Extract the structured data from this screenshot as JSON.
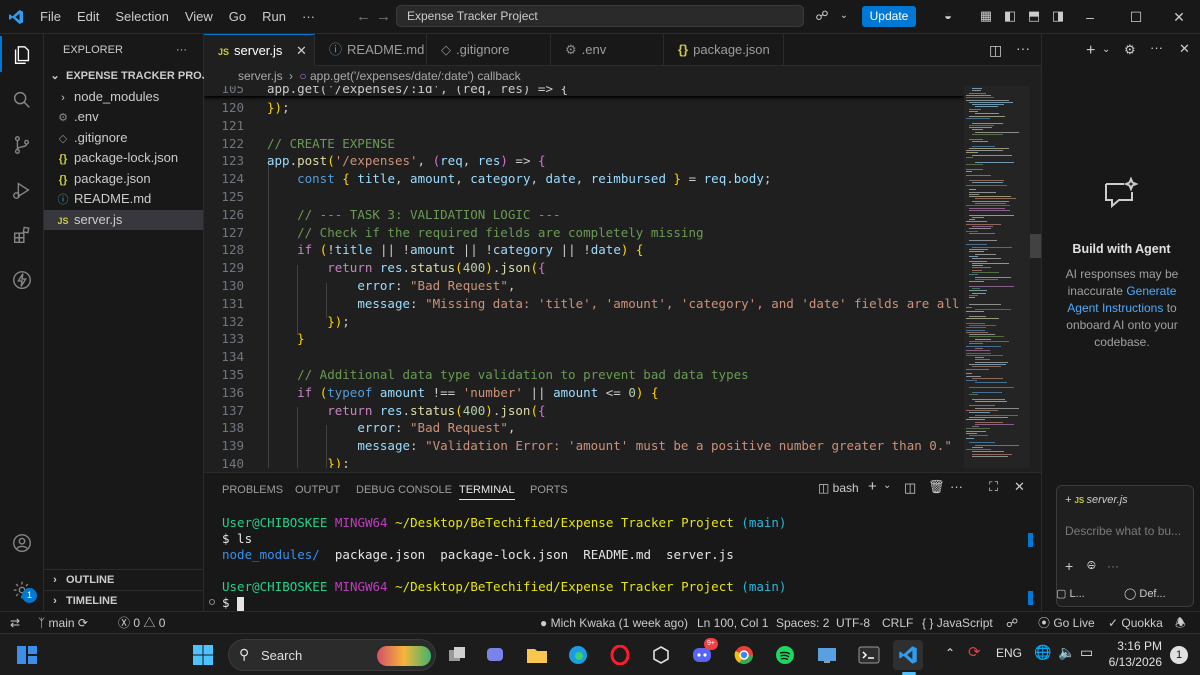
{
  "titlebar": {
    "menu": [
      "File",
      "Edit",
      "Selection",
      "View",
      "Go",
      "Run",
      "···"
    ],
    "command_center": "Expense Tracker Project",
    "update_label": "Update"
  },
  "explorer": {
    "title": "EXPLORER",
    "project": "EXPENSE TRACKER PROJECT",
    "items": [
      {
        "icon": "›",
        "label": "node_modules"
      },
      {
        "icon": "⚙",
        "label": ".env"
      },
      {
        "icon": "◇",
        "label": ".gitignore"
      },
      {
        "icon": "{}",
        "label": "package-lock.json"
      },
      {
        "icon": "{}",
        "label": "package.json"
      },
      {
        "icon": "ⓘ",
        "label": "README.md"
      },
      {
        "icon": "JS",
        "label": "server.js"
      }
    ],
    "outline": "OUTLINE",
    "timeline": "TIMELINE",
    "accounts_badge": "1"
  },
  "tabs": [
    {
      "icon": "JS",
      "label": "server.js"
    },
    {
      "icon": "ⓘ",
      "label": "README.md"
    },
    {
      "icon": "◇",
      "label": ".gitignore"
    },
    {
      "icon": "⚙",
      "label": ".env"
    },
    {
      "icon": "{}",
      "label": "package.json"
    }
  ],
  "breadcrumbs": {
    "file": "server.js",
    "separator": "›",
    "symbol": "app.get('/expenses/date/:date') callback"
  },
  "code": {
    "sticky_line_number": "105",
    "sticky_text": "app.get('/expenses/:id', (req, res) => {",
    "line_numbers": [
      "120",
      "121",
      "122",
      "123",
      "124",
      "125",
      "126",
      "127",
      "128",
      "129",
      "130",
      "131",
      "132",
      "133",
      "134",
      "135",
      "136",
      "137",
      "138",
      "139",
      "140"
    ],
    "lines": [
      "});",
      "",
      "// CREATE EXPENSE",
      "app.post('/expenses', (req, res) => {",
      "    const { title, amount, category, date, reimbursed } = req.body;",
      "",
      "    // --- TASK 3: VALIDATION LOGIC ---",
      "    // Check if the required fields are completely missing",
      "    if (!title || !amount || !category || !date) {",
      "        return res.status(400).json({",
      "            error: \"Bad Request\",",
      "            message: \"Missing data: 'title', 'amount', 'category', and 'date' fields are all req",
      "        });",
      "    }",
      "",
      "    // Additional data type validation to prevent bad data types",
      "    if (typeof amount !== 'number' || amount <= 0) {",
      "        return res.status(400).json({",
      "            error: \"Bad Request\",",
      "            message: \"Validation Error: 'amount' must be a positive number greater than 0.\"",
      "        });"
    ]
  },
  "panel": {
    "tabs": [
      "PROBLEMS",
      "OUTPUT",
      "DEBUG CONSOLE",
      "TERMINAL",
      "PORTS"
    ],
    "shell": "bash",
    "terminal": {
      "prompt_user": "User@CHIBOSKEE",
      "prompt_env": "MINGW64",
      "prompt_path": "~/Desktop/BeTechified/Expense Tracker Project",
      "prompt_branch": "(main)",
      "command": "$ ls",
      "ls_dir": "node_modules/",
      "ls_files": "  package.json  package-lock.json  README.md  server.js",
      "cursor_prompt": "$"
    }
  },
  "chat": {
    "title": "Build with Agent",
    "desc1": "AI responses may be inaccurate",
    "link": "Generate Agent Instructions",
    "desc2": "to onboard AI onto your codebase.",
    "context_file": "server.js",
    "input_placeholder": "Describe what to bu...",
    "footer_left": "L...",
    "footer_right": "Def..."
  },
  "statusbar": {
    "branch": "main",
    "errors": "0",
    "warnings": "0",
    "blame": "Mich Kwaka (1 week ago)",
    "position": "Ln 100, Col 1",
    "spaces": "Spaces: 2",
    "encoding": "UTF-8",
    "eol": "CRLF",
    "language": "JavaScript",
    "golive": "Go Live",
    "quokka": "Quokka"
  },
  "taskbar": {
    "search": "Search",
    "lang": "ENG",
    "time": "3:16 PM",
    "date": "6/13/2026",
    "notification_count": "1",
    "discord_badge": "9+"
  },
  "colors": {
    "accent": "#0078d4",
    "keyword": "#569cd6",
    "control": "#c586c0",
    "function": "#dcdcaa",
    "string": "#ce9178",
    "variable": "#9cdcfe",
    "number": "#b5cea8",
    "comment": "#6a9955",
    "terminal_user": "#23d18b",
    "terminal_env": "#bc3fbc",
    "terminal_path": "#e5e510",
    "terminal_branch": "#29b8db"
  }
}
